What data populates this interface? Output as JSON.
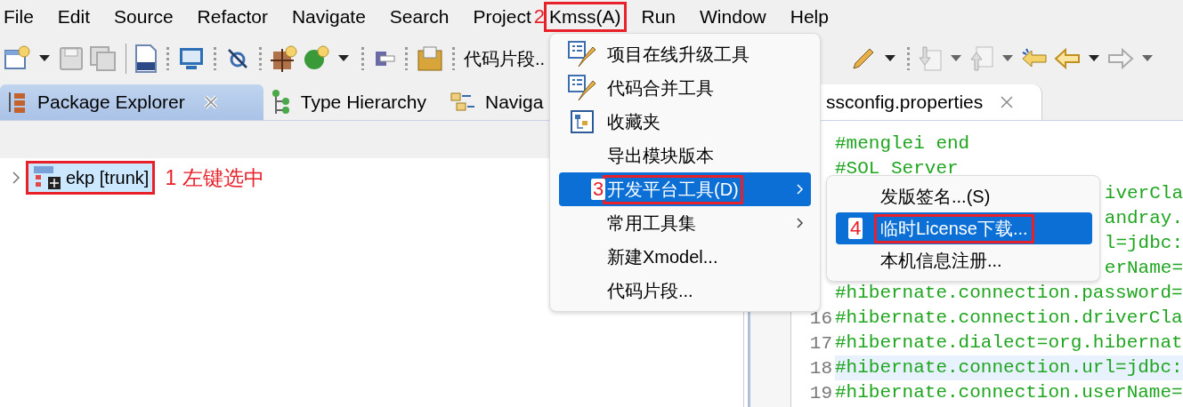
{
  "menubar": [
    {
      "label": "File"
    },
    {
      "label": "Edit"
    },
    {
      "label": "Source"
    },
    {
      "label": "Refactor"
    },
    {
      "label": "Navigate"
    },
    {
      "label": "Search"
    },
    {
      "label": "Project"
    },
    {
      "label": "Kmss(A)",
      "annotation": "2"
    },
    {
      "label": "Run"
    },
    {
      "label": "Window"
    },
    {
      "label": "Help"
    }
  ],
  "toolbar": {
    "snippet_label": "代码片段.."
  },
  "left_panel": {
    "tabs": [
      {
        "label": "Package Explorer",
        "selected": true,
        "closable": true
      },
      {
        "label": "Type Hierarchy",
        "selected": false,
        "closable": false
      },
      {
        "label": "Naviga",
        "selected": false,
        "closable": false
      }
    ],
    "tree": [
      {
        "label": "ekp [trunk]",
        "selected": true,
        "expanded": false,
        "annotation": "1 左键选中"
      }
    ]
  },
  "editor": {
    "tab": {
      "label": "ssconfig.properties"
    },
    "lines": [
      {
        "kind": "full",
        "text": "#menglei end",
        "current": false
      },
      {
        "kind": "full",
        "text": "#SOL Server",
        "current": false
      },
      {
        "kind": "tail",
        "text": "iverCla",
        "current": false
      },
      {
        "kind": "tail",
        "text": "andray.",
        "current": false
      },
      {
        "kind": "tail",
        "text": "l=jdbc:",
        "current": false
      },
      {
        "kind": "tail",
        "text": "erName=",
        "current": false
      },
      {
        "kind": "full",
        "text": "#hibernate.connection.password=",
        "current": false
      },
      {
        "kind": "full",
        "number": "16",
        "text": "#hibernate.connection.driverCla",
        "current": false
      },
      {
        "kind": "full",
        "number": "17",
        "text": "#hibernate.dialect=org.hibernat",
        "current": false
      },
      {
        "kind": "full",
        "number": "18",
        "text": "#hibernate.connection.url=jdbc:",
        "current": true
      },
      {
        "kind": "full",
        "number": "19",
        "text": "#hibernate.connection.userName=",
        "current": false
      }
    ]
  },
  "menu": {
    "items": [
      {
        "label": "项目在线升级工具",
        "kind": "tool",
        "selected": false,
        "submenu": false
      },
      {
        "label": "代码合并工具",
        "kind": "tool",
        "selected": false,
        "submenu": false
      },
      {
        "label": "收藏夹",
        "kind": "favorites",
        "selected": false,
        "submenu": false
      },
      {
        "label": "导出模块版本",
        "kind": "plain",
        "selected": false,
        "submenu": false
      },
      {
        "label": "开发平台工具(D)",
        "kind": "plain",
        "selected": true,
        "submenu": true,
        "annotation": "3"
      },
      {
        "label": "常用工具集",
        "kind": "plain",
        "selected": false,
        "submenu": true
      },
      {
        "label": "新建Xmodel...",
        "kind": "plain",
        "selected": false,
        "submenu": false
      },
      {
        "label": "代码片段...",
        "kind": "plain",
        "selected": false,
        "submenu": false
      }
    ]
  },
  "submenu": {
    "items": [
      {
        "label": "发版签名...(S)",
        "selected": false
      },
      {
        "label": "临时License下载...",
        "selected": true,
        "annotation": "4"
      },
      {
        "label": "本机信息注册...",
        "selected": false
      }
    ]
  }
}
